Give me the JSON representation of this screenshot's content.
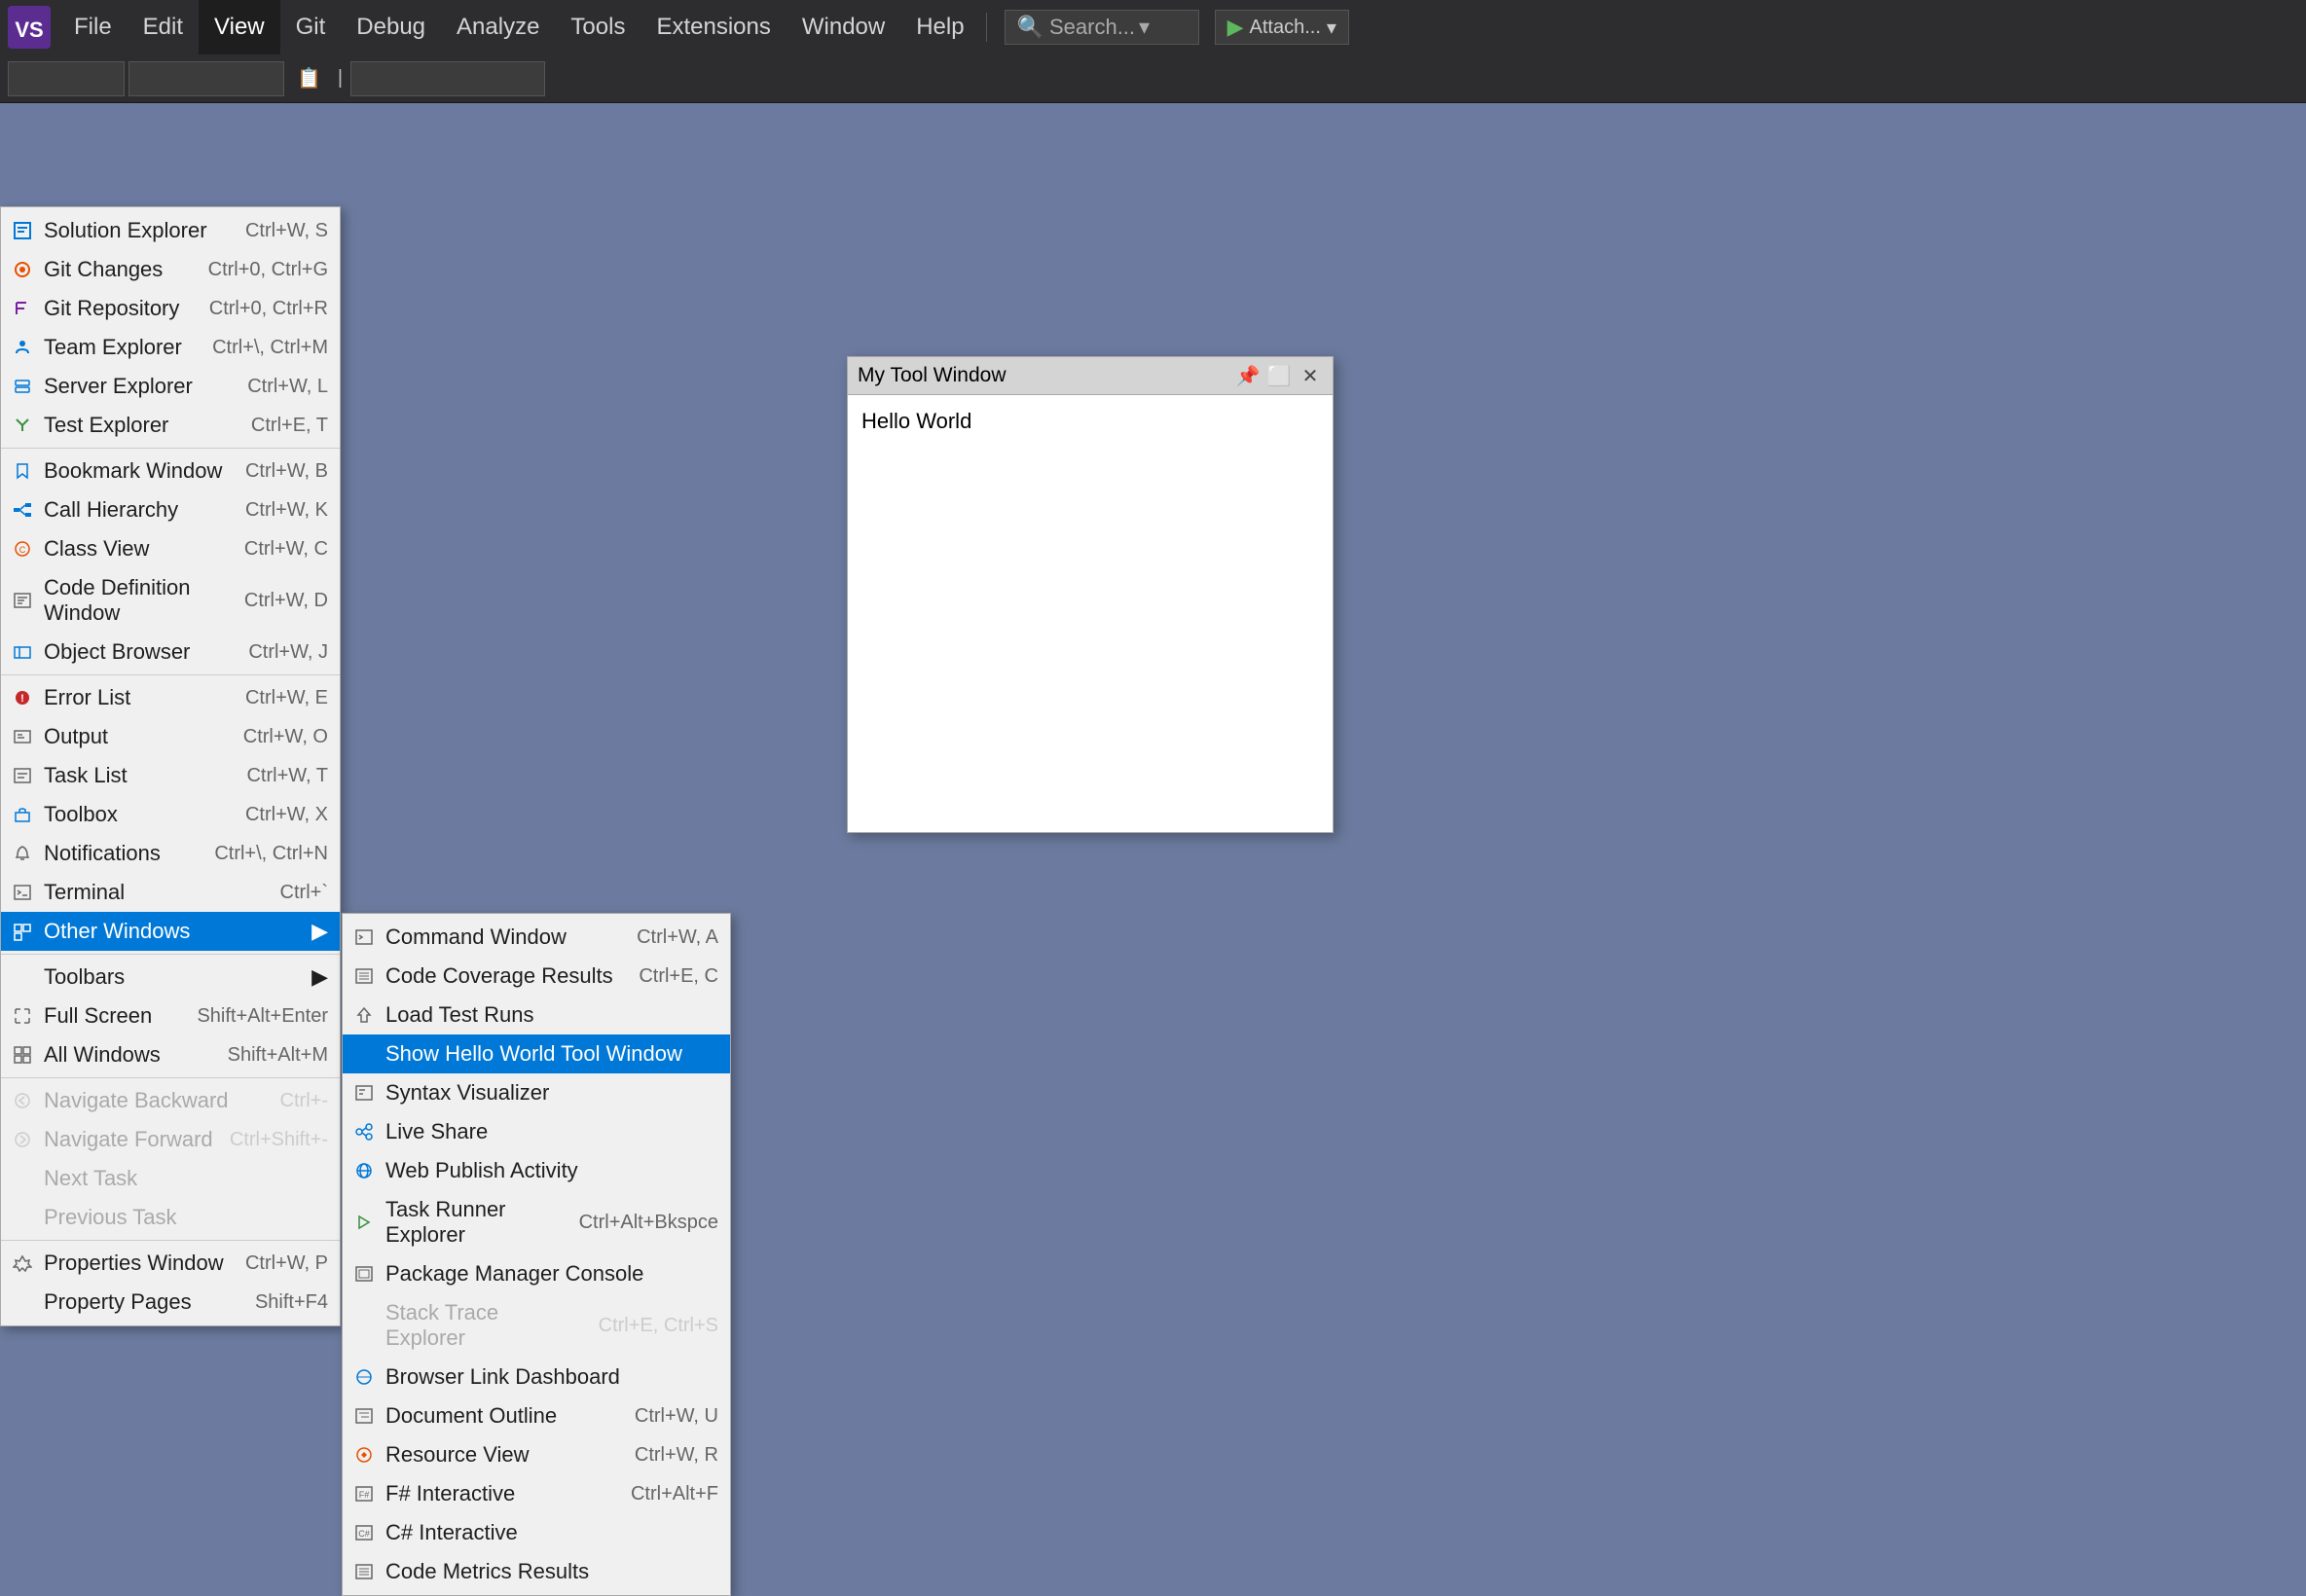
{
  "app": {
    "title": "Visual Studio",
    "logo": "VS"
  },
  "menubar": {
    "items": [
      {
        "id": "file",
        "label": "File"
      },
      {
        "id": "edit",
        "label": "Edit"
      },
      {
        "id": "view",
        "label": "View",
        "active": true
      },
      {
        "id": "git",
        "label": "Git"
      },
      {
        "id": "debug",
        "label": "Debug"
      },
      {
        "id": "analyze",
        "label": "Analyze"
      },
      {
        "id": "tools",
        "label": "Tools"
      },
      {
        "id": "extensions",
        "label": "Extensions"
      },
      {
        "id": "window",
        "label": "Window"
      },
      {
        "id": "help",
        "label": "Help"
      }
    ],
    "search_placeholder": "Search..."
  },
  "view_menu": {
    "items": [
      {
        "id": "solution-explorer",
        "label": "Solution Explorer",
        "shortcut": "Ctrl+W, S",
        "icon": "window"
      },
      {
        "id": "git-changes",
        "label": "Git Changes",
        "shortcut": "Ctrl+0, Ctrl+G",
        "icon": "git"
      },
      {
        "id": "git-repository",
        "label": "Git Repository",
        "shortcut": "Ctrl+0, Ctrl+R",
        "icon": "branch"
      },
      {
        "id": "team-explorer",
        "label": "Team Explorer",
        "shortcut": "Ctrl+\\, Ctrl+M",
        "icon": "team"
      },
      {
        "id": "server-explorer",
        "label": "Server Explorer",
        "shortcut": "Ctrl+W, L",
        "icon": "server"
      },
      {
        "id": "test-explorer",
        "label": "Test Explorer",
        "shortcut": "Ctrl+E, T",
        "icon": "test"
      },
      {
        "separator": true
      },
      {
        "id": "bookmark-window",
        "label": "Bookmark Window",
        "shortcut": "Ctrl+W, B",
        "icon": "bookmark"
      },
      {
        "id": "call-hierarchy",
        "label": "Call Hierarchy",
        "shortcut": "Ctrl+W, K",
        "icon": "hierarchy"
      },
      {
        "id": "class-view",
        "label": "Class View",
        "shortcut": "Ctrl+W, C",
        "icon": "class"
      },
      {
        "id": "code-definition",
        "label": "Code Definition Window",
        "shortcut": "Ctrl+W, D",
        "icon": "code"
      },
      {
        "id": "object-browser",
        "label": "Object Browser",
        "shortcut": "Ctrl+W, J",
        "icon": "object"
      },
      {
        "separator2": true
      },
      {
        "id": "error-list",
        "label": "Error List",
        "shortcut": "Ctrl+W, E",
        "icon": "error"
      },
      {
        "id": "output",
        "label": "Output",
        "shortcut": "Ctrl+W, O",
        "icon": "output"
      },
      {
        "id": "task-list",
        "label": "Task List",
        "shortcut": "Ctrl+W, T",
        "icon": "task"
      },
      {
        "id": "toolbox",
        "label": "Toolbox",
        "shortcut": "Ctrl+W, X",
        "icon": "toolbox"
      },
      {
        "id": "notifications",
        "label": "Notifications",
        "shortcut": "Ctrl+\\, Ctrl+N",
        "icon": "bell"
      },
      {
        "id": "terminal",
        "label": "Terminal",
        "shortcut": "Ctrl+`",
        "icon": "terminal"
      },
      {
        "id": "other-windows",
        "label": "Other Windows",
        "shortcut": "",
        "icon": "",
        "arrow": true,
        "highlighted": true
      },
      {
        "separator3": true
      },
      {
        "id": "toolbars",
        "label": "Toolbars",
        "shortcut": "",
        "arrow": true
      },
      {
        "id": "full-screen",
        "label": "Full Screen",
        "shortcut": "Shift+Alt+Enter"
      },
      {
        "id": "all-windows",
        "label": "All Windows",
        "shortcut": "Shift+Alt+M"
      },
      {
        "separator4": true
      },
      {
        "id": "navigate-backward",
        "label": "Navigate Backward",
        "shortcut": "Ctrl+-",
        "disabled": true
      },
      {
        "id": "navigate-forward",
        "label": "Navigate Forward",
        "shortcut": "Ctrl+Shift+-",
        "disabled": true
      },
      {
        "id": "next-task",
        "label": "Next Task",
        "shortcut": "",
        "disabled": true
      },
      {
        "id": "previous-task",
        "label": "Previous Task",
        "shortcut": "",
        "disabled": true
      },
      {
        "separator5": true
      },
      {
        "id": "properties-window",
        "label": "Properties Window",
        "shortcut": "Ctrl+W, P",
        "icon": "properties"
      },
      {
        "id": "property-pages",
        "label": "Property Pages",
        "shortcut": "Shift+F4"
      }
    ]
  },
  "other_windows_submenu": {
    "items": [
      {
        "id": "command-window",
        "label": "Command Window",
        "shortcut": "Ctrl+W, A",
        "icon": "cmd"
      },
      {
        "id": "code-coverage",
        "label": "Code Coverage Results",
        "shortcut": "Ctrl+E, C",
        "icon": "coverage"
      },
      {
        "id": "load-test-runs",
        "label": "Load Test Runs",
        "shortcut": "",
        "icon": "load"
      },
      {
        "id": "show-hello-world",
        "label": "Show Hello World Tool Window",
        "shortcut": "",
        "highlighted": true
      },
      {
        "id": "syntax-visualizer",
        "label": "Syntax Visualizer",
        "shortcut": "",
        "icon": "syntax"
      },
      {
        "id": "live-share",
        "label": "Live Share",
        "shortcut": "",
        "icon": "live"
      },
      {
        "id": "web-publish",
        "label": "Web Publish Activity",
        "shortcut": "",
        "icon": "web"
      },
      {
        "id": "task-runner",
        "label": "Task Runner Explorer",
        "shortcut": "Ctrl+Alt+Bkspce",
        "icon": "runner"
      },
      {
        "id": "package-manager",
        "label": "Package Manager Console",
        "shortcut": "",
        "icon": "package"
      },
      {
        "id": "stack-trace",
        "label": "Stack Trace Explorer",
        "shortcut": "Ctrl+E, Ctrl+S",
        "disabled": true
      },
      {
        "id": "browser-link",
        "label": "Browser Link Dashboard",
        "shortcut": "",
        "icon": "browser"
      },
      {
        "id": "document-outline",
        "label": "Document Outline",
        "shortcut": "Ctrl+W, U",
        "icon": "outline"
      },
      {
        "id": "resource-view",
        "label": "Resource View",
        "shortcut": "Ctrl+W, R",
        "icon": "resource"
      },
      {
        "id": "fsharp-interactive",
        "label": "F# Interactive",
        "shortcut": "Ctrl+Alt+F",
        "icon": "fsharp"
      },
      {
        "id": "csharp-interactive",
        "label": "C# Interactive",
        "shortcut": "",
        "icon": "csharp"
      },
      {
        "id": "code-metrics",
        "label": "Code Metrics Results",
        "shortcut": "",
        "icon": "metrics"
      }
    ]
  },
  "tool_window": {
    "title": "My Tool Window",
    "content": "Hello World",
    "controls": [
      "pin",
      "maximize",
      "close"
    ]
  }
}
